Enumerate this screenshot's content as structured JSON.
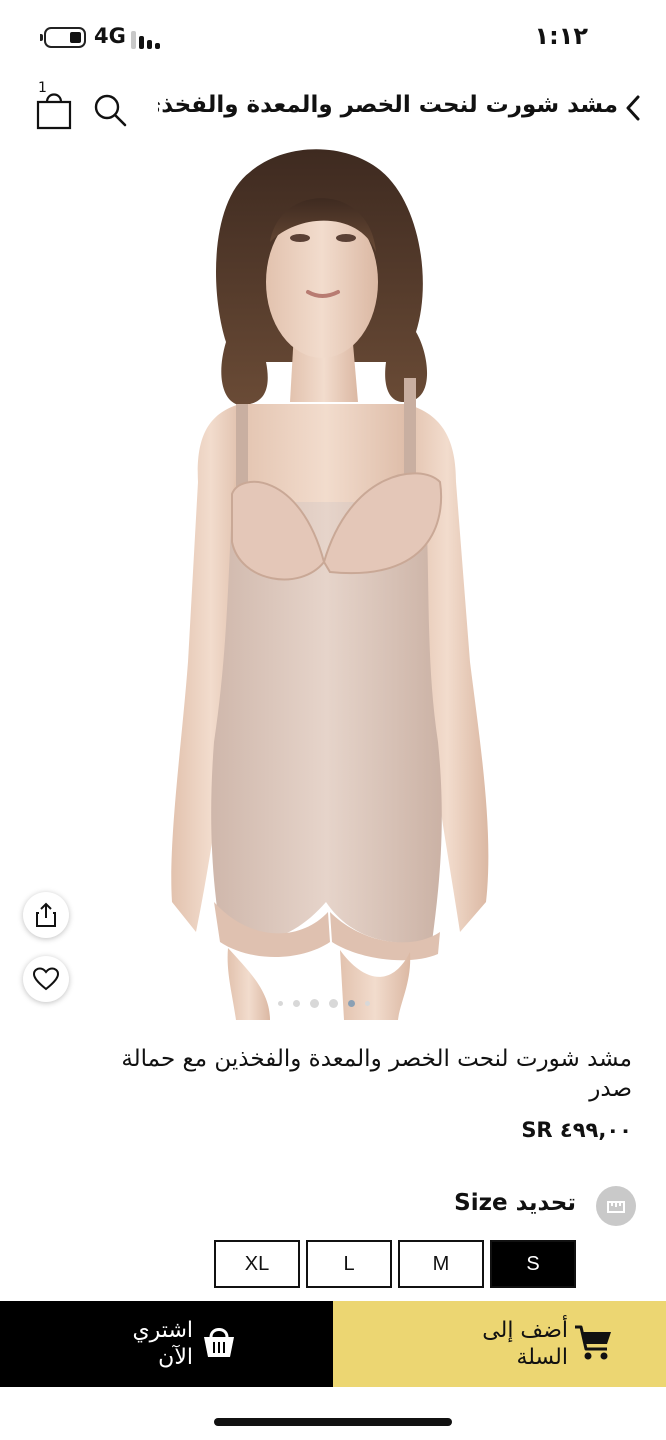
{
  "status_bar": {
    "network": "4G",
    "time": "١:١٢"
  },
  "header": {
    "cart_count": "1",
    "title": "مشد شورت لنحت الخصر والمعدة والفخذي..."
  },
  "gallery": {
    "total_images": 6,
    "active_index": 4
  },
  "product": {
    "title": "مشد شورت لنحت الخصر والمعدة والفخذين مع حمالة صدر",
    "price": "٤٩٩,٠٠ SR"
  },
  "size": {
    "label": "تحديد Size",
    "options": [
      "S",
      "M",
      "L",
      "XL"
    ],
    "selected": "S"
  },
  "actions": {
    "buy_now": "اشتري الآن",
    "add_to_cart": "أضف إلى السلة"
  },
  "colors": {
    "add_to_cart_bg": "#ecd672",
    "buy_now_bg": "#000000",
    "selected_size_bg": "#000000"
  }
}
